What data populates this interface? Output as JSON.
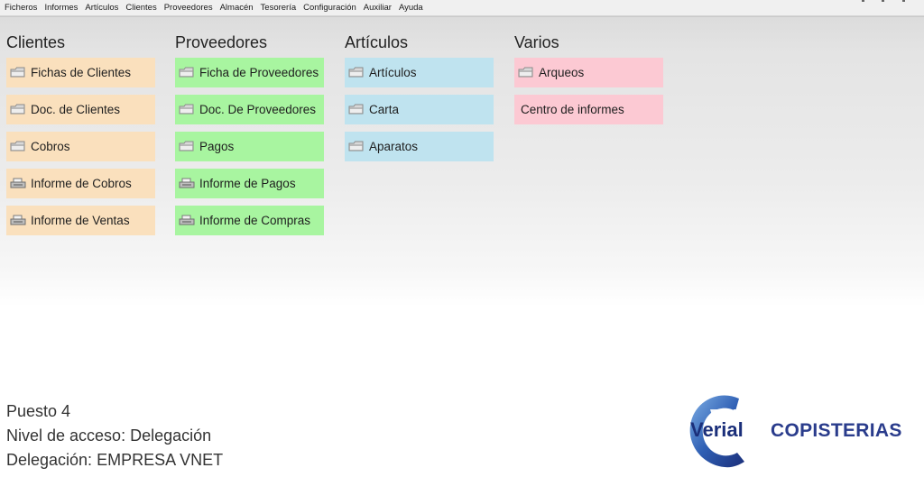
{
  "menu": [
    "Ficheros",
    "Informes",
    "Artículos",
    "Clientes",
    "Proveedores",
    "Almacén",
    "Tesorería",
    "Configuración",
    "Auxiliar",
    "Ayuda"
  ],
  "sections": {
    "clientes": {
      "title": "Clientes",
      "color": "#fae0bd",
      "items": [
        "Fichas de Clientes",
        "Doc. de Clientes",
        "Cobros",
        "Informe de Cobros",
        "Informe de Ventas"
      ]
    },
    "proveedores": {
      "title": "Proveedores",
      "color": "#a8f5a0",
      "items": [
        "Ficha de Proveedores",
        "Doc. De Proveedores",
        "Pagos",
        "Informe de Pagos",
        "Informe de Compras"
      ]
    },
    "articulos": {
      "title": "Artículos",
      "color": "#bfe3ef",
      "items": [
        "Artículos",
        "Carta",
        "Aparatos"
      ]
    },
    "varios": {
      "title": "Varios",
      "color": "#fcc9d3",
      "items": [
        "Arqueos",
        "Centro de informes"
      ]
    }
  },
  "icons": {
    "folder": "folder-icon",
    "printer": "printer-icon"
  },
  "footer": {
    "puesto": "Puesto 4",
    "nivel": "Nivel de acceso: Delegación",
    "delegacion": "Delegación: EMPRESA VNET"
  },
  "logo": {
    "text": "Verial",
    "brand": "COPISTERIAS",
    "brand_color": "#2a3c8c"
  }
}
